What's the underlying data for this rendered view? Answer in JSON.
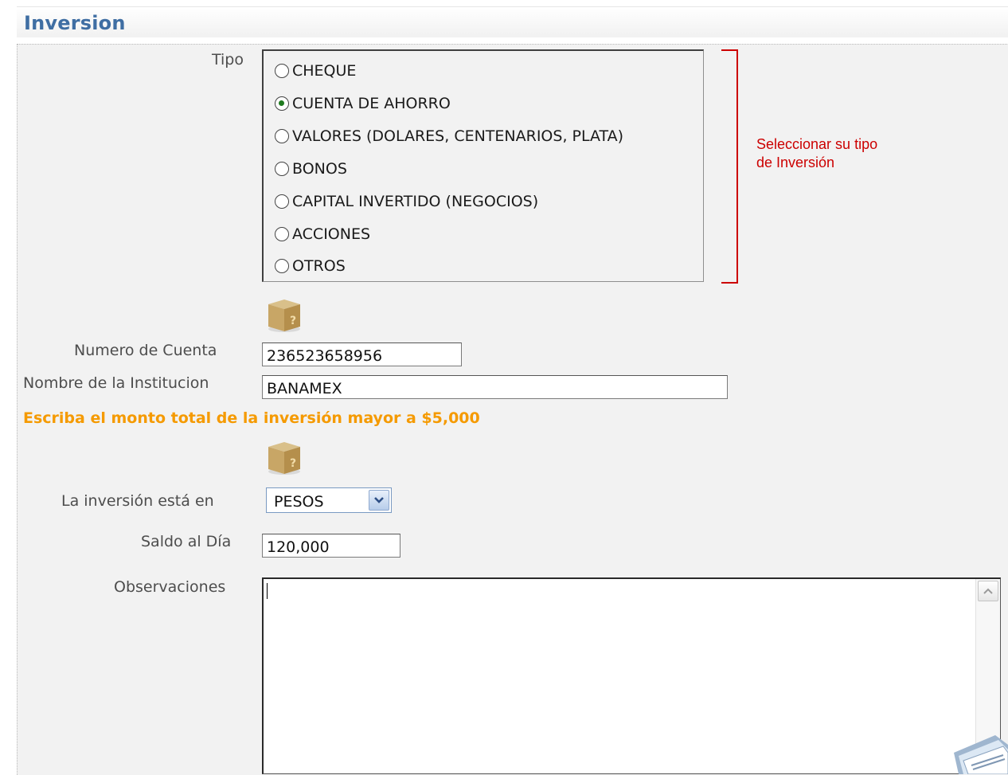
{
  "section": {
    "title": "Inversion"
  },
  "tipo": {
    "label": "Tipo",
    "options": [
      {
        "label": "CHEQUE",
        "checked": false
      },
      {
        "label": "CUENTA DE AHORRO",
        "checked": true
      },
      {
        "label": "VALORES (DOLARES, CENTENARIOS, PLATA)",
        "checked": false
      },
      {
        "label": "BONOS",
        "checked": false
      },
      {
        "label": "CAPITAL INVERTIDO (NEGOCIOS)",
        "checked": false
      },
      {
        "label": "ACCIONES",
        "checked": false
      },
      {
        "label": "OTROS",
        "checked": false
      }
    ],
    "annotation_line1": "Seleccionar su tipo",
    "annotation_line2": "de Inversión"
  },
  "fields": {
    "numero_cuenta": {
      "label": "Numero de Cuenta",
      "value": "236523658956"
    },
    "nombre_institucion": {
      "label": "Nombre de la Institucion",
      "value": "BANAMEX"
    },
    "monto_note": "Escriba el monto total de la inversión mayor a $5,000",
    "moneda": {
      "label": "La inversión está en",
      "selected": "PESOS"
    },
    "saldo": {
      "label": "Saldo al Día",
      "value": "120,000"
    },
    "observaciones": {
      "label": "Observaciones",
      "value": ""
    }
  },
  "icons": {
    "help": "help-box-icon",
    "dropdown": "chevron-down-icon",
    "scroll_up": "scroll-up-arrow-icon",
    "corner": "document-stack-icon"
  },
  "colors": {
    "title": "#3f6ea3",
    "annotation": "#cc0000",
    "warning": "#f59a00",
    "panel_bg": "#f2f2f2"
  }
}
